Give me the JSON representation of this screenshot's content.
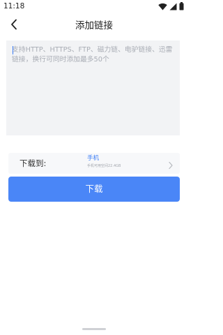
{
  "status_bar": {
    "time": "11:18",
    "icons": [
      "wifi-icon",
      "signal-icon",
      "battery-icon"
    ]
  },
  "header": {
    "title": "添加链接",
    "back_icon": "back-arrow-icon"
  },
  "link_input": {
    "value": "",
    "placeholder": "支持HTTP、HTTPS、FTP、磁力链、电驴链接、迅雷链接，换行可同时添加最多50个"
  },
  "destination": {
    "label": "下载到:",
    "name": "手机",
    "space": "手机可用空间22.4GB",
    "chevron_icon": "chevron-right-icon"
  },
  "download_button": {
    "label": "下载"
  },
  "colors": {
    "accent": "#4a86f7",
    "link_text": "#3d7ef6",
    "input_bg": "#f2f3f5",
    "row_bg": "#f7f8fa"
  }
}
